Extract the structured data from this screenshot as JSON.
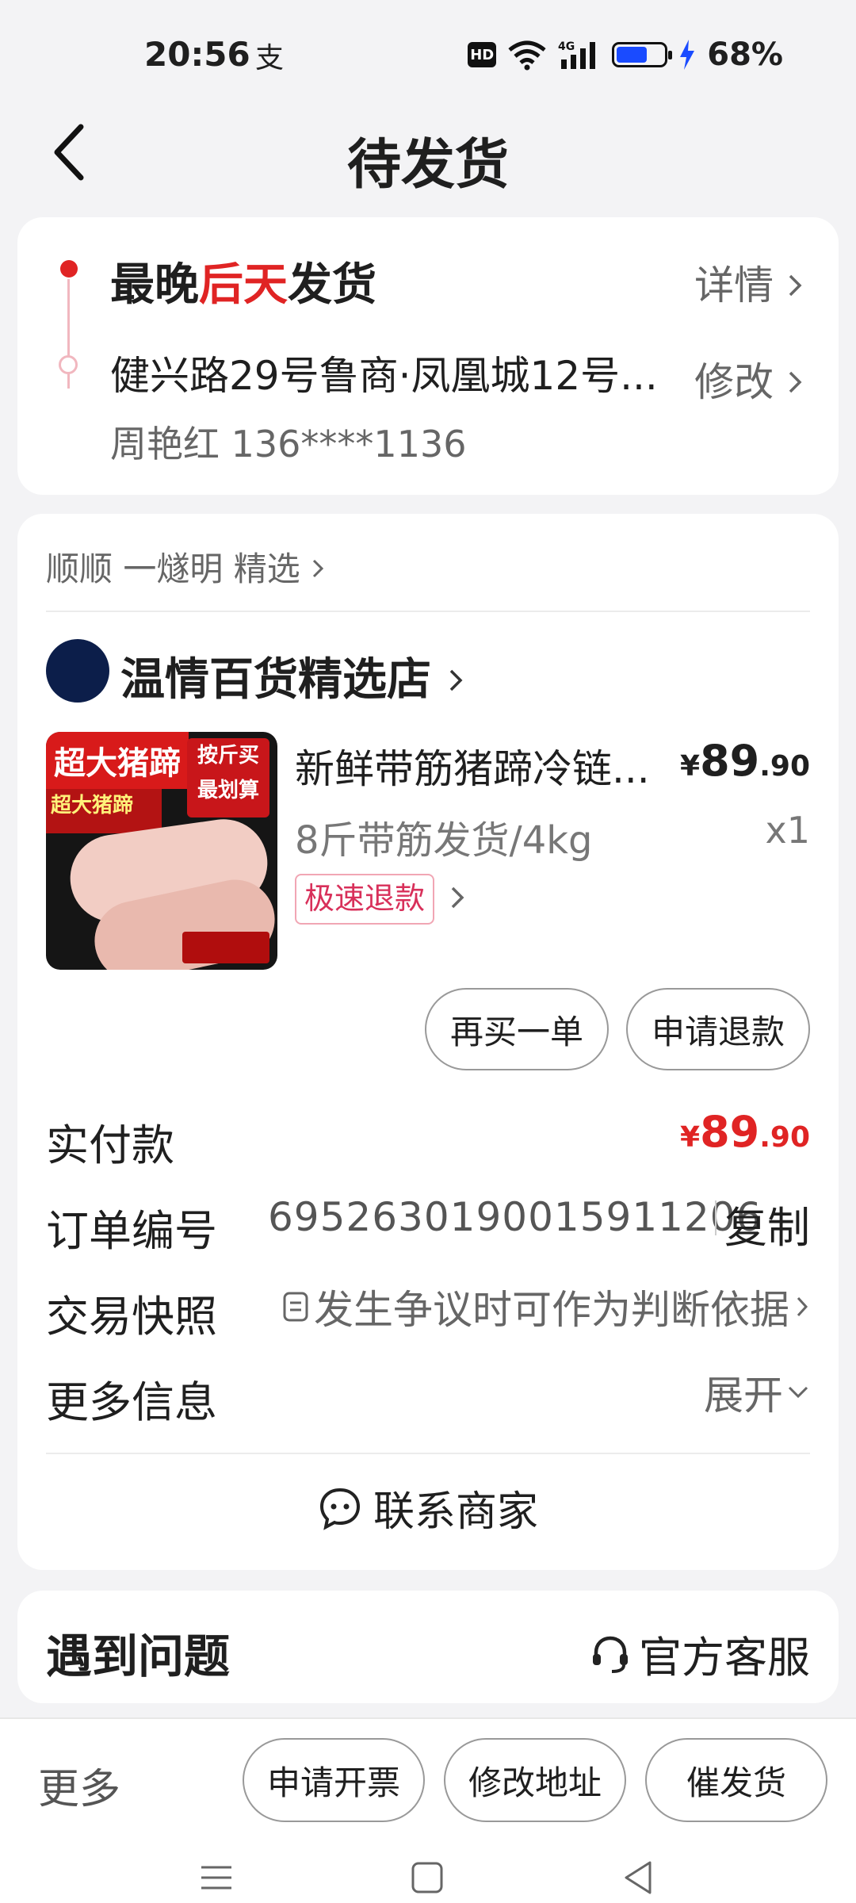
{
  "status_bar": {
    "time": "20:56",
    "notification_icon": "支",
    "hd_badge": "HD",
    "battery_percent": "68%",
    "battery_level": 0.68
  },
  "header": {
    "title": "待发货"
  },
  "shipping": {
    "title_prefix": "最晚",
    "title_highlight": "后天",
    "title_suffix": "发货",
    "detail_link": "详情",
    "address": "健兴路29号鲁商·凤凰城12号...",
    "modify_link": "修改",
    "contact": "周艳红 136****1136"
  },
  "order": {
    "brand_line": "顺顺 一燧明 精选",
    "shop_name": "温情百货精选店",
    "product": {
      "name": "新鲜带筋猪蹄冷链...",
      "price_symbol": "¥",
      "price_int": "89",
      "price_dec": ".90",
      "spec": "8斤带筋发货/4kg",
      "quantity": "x1",
      "refund_tag": "极速退款",
      "image_banner": "超大猪蹄",
      "image_sub": "超大猪蹄",
      "image_side_1": "按斤买",
      "image_side_2": "最划算"
    },
    "buttons": {
      "rebuy": "再买一单",
      "refund": "申请退款"
    },
    "paid_label": "实付款",
    "paid_symbol": "¥",
    "paid_int": "89",
    "paid_dec": ".90",
    "order_no_label": "订单编号",
    "order_no": "6952630190015911206",
    "copy": "复制",
    "snapshot_label": "交易快照",
    "snapshot_text": "发生争议时可作为判断依据",
    "more_info_label": "更多信息",
    "expand": "展开",
    "contact_seller": "联系商家"
  },
  "problems": {
    "title": "遇到问题",
    "service": "官方客服"
  },
  "bottom_bar": {
    "more": "更多",
    "invoice": "申请开票",
    "change_address": "修改地址",
    "urge": "催发货"
  }
}
